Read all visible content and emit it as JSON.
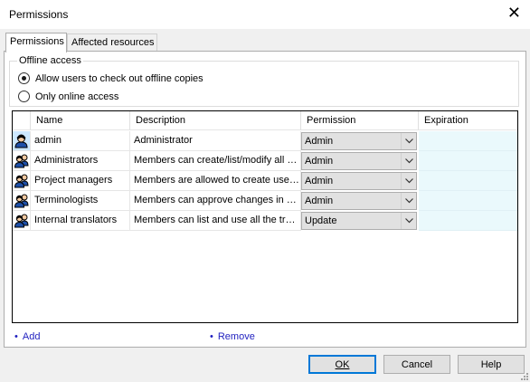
{
  "window": {
    "title": "Permissions",
    "close_glyph": "✕"
  },
  "tabs": [
    {
      "label": "Permissions",
      "active": true
    },
    {
      "label": "Affected resources",
      "active": false
    }
  ],
  "offline_access": {
    "legend": "Offline access",
    "options": [
      {
        "label": "Allow users to check out offline copies",
        "checked": true
      },
      {
        "label": "Only online access",
        "checked": false
      }
    ]
  },
  "grid": {
    "columns": {
      "name": "Name",
      "description": "Description",
      "permission": "Permission",
      "expiration": "Expiration"
    },
    "rows": [
      {
        "icon": "user-icon",
        "name": "admin",
        "description": "Administrator",
        "permission": "Admin",
        "expiration": ""
      },
      {
        "icon": "group-icon",
        "name": "Administrators",
        "description": "Members can create/list/modify all e...",
        "permission": "Admin",
        "expiration": ""
      },
      {
        "icon": "group-icon",
        "name": "Project managers",
        "description": "Members are allowed to create user...",
        "permission": "Admin",
        "expiration": ""
      },
      {
        "icon": "group-icon",
        "name": "Terminologists",
        "description": "Members can approve changes in m...",
        "permission": "Admin",
        "expiration": ""
      },
      {
        "icon": "group-icon",
        "name": "Internal translators",
        "description": "Members can list and use all the tran...",
        "permission": "Update",
        "expiration": ""
      }
    ]
  },
  "links": {
    "bullet": "•",
    "add": "Add",
    "remove": "Remove"
  },
  "buttons": {
    "ok": "OK",
    "cancel": "Cancel",
    "help": "Help"
  },
  "colors": {
    "link": "#1f1fbf",
    "expiration_bg": "#eaf9fc",
    "default_button_border": "#0078d7"
  }
}
